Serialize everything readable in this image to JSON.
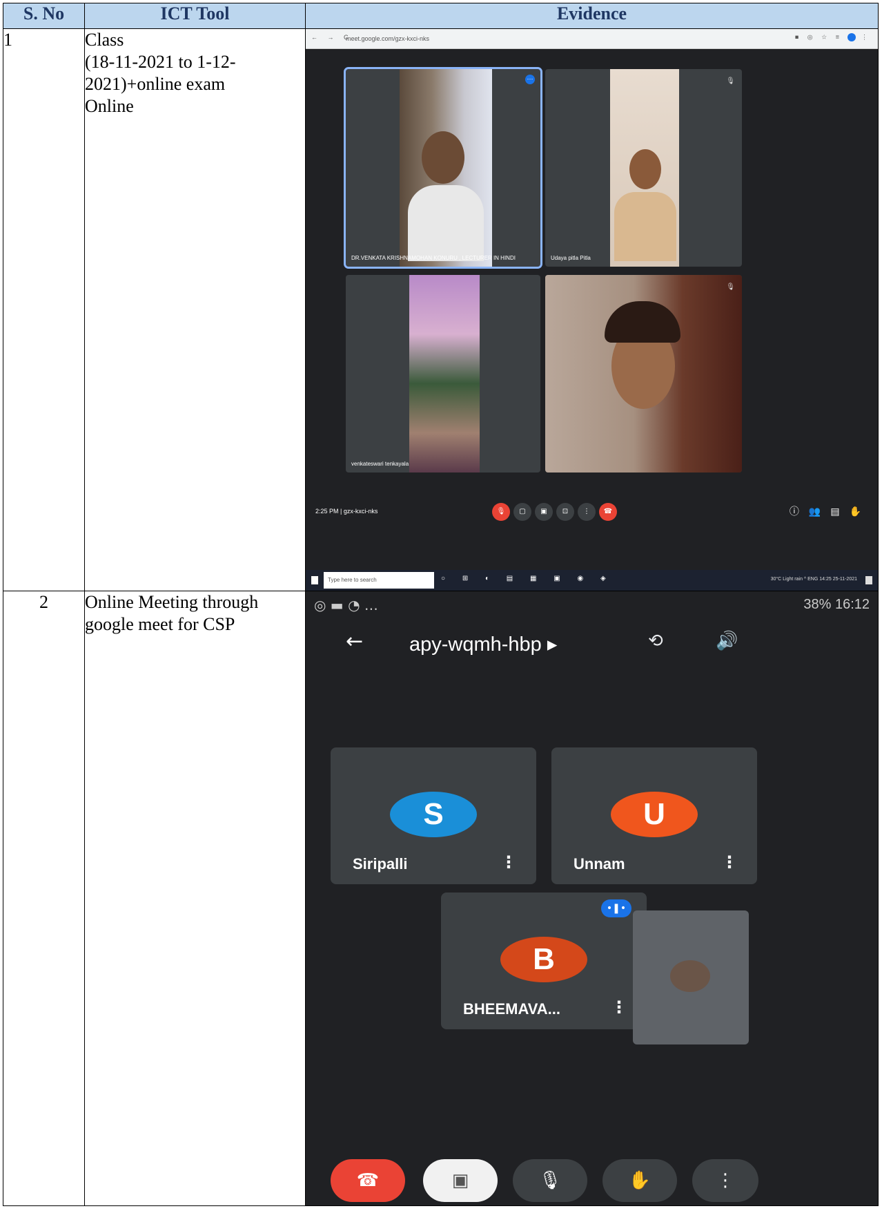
{
  "table": {
    "headers": {
      "sno": "S. No",
      "tool": "ICT Tool",
      "evidence": "Evidence"
    },
    "rows": [
      {
        "sno": "1",
        "tool_lines": [
          "Class",
          "(18-11-2021 to 1-12-",
          "2021)+online exam",
          "Online"
        ]
      },
      {
        "sno": "2",
        "tool_lines": [
          "Online Meeting through",
          "google meet for CSP"
        ]
      }
    ]
  },
  "desktop_meet": {
    "url": "meet.google.com/gzx-kxci-nks",
    "tiles": [
      {
        "name": "DR.VENKATA KRISHNAMOHAN KONURU , LECTURER IN HINDI"
      },
      {
        "name": "Udaya pitla Pitla"
      },
      {
        "name": "venkateswari tenkayala"
      },
      {
        "name": ""
      }
    ],
    "meeting_info": "2:25 PM  |  gzx-kxci-nks",
    "search_placeholder": "Type here to search",
    "tray": "30°C Light rain  ^  ENG  14:25  25-11-2021",
    "participant_count": "4"
  },
  "mobile_meet": {
    "status_right": "38% 16:12",
    "meeting_code": "apy-wqmh-hbp ▸",
    "participants": [
      {
        "initial": "S",
        "name": "Siripalli",
        "color": "#1a8fd8"
      },
      {
        "initial": "U",
        "name": "Unnam",
        "color": "#f0561d"
      },
      {
        "initial": "B",
        "name": "BHEEMAVA...",
        "color": "#d4481a"
      }
    ],
    "colors": {
      "end_call": "#ea4335",
      "background": "#202124",
      "tile": "#3c4043"
    }
  }
}
